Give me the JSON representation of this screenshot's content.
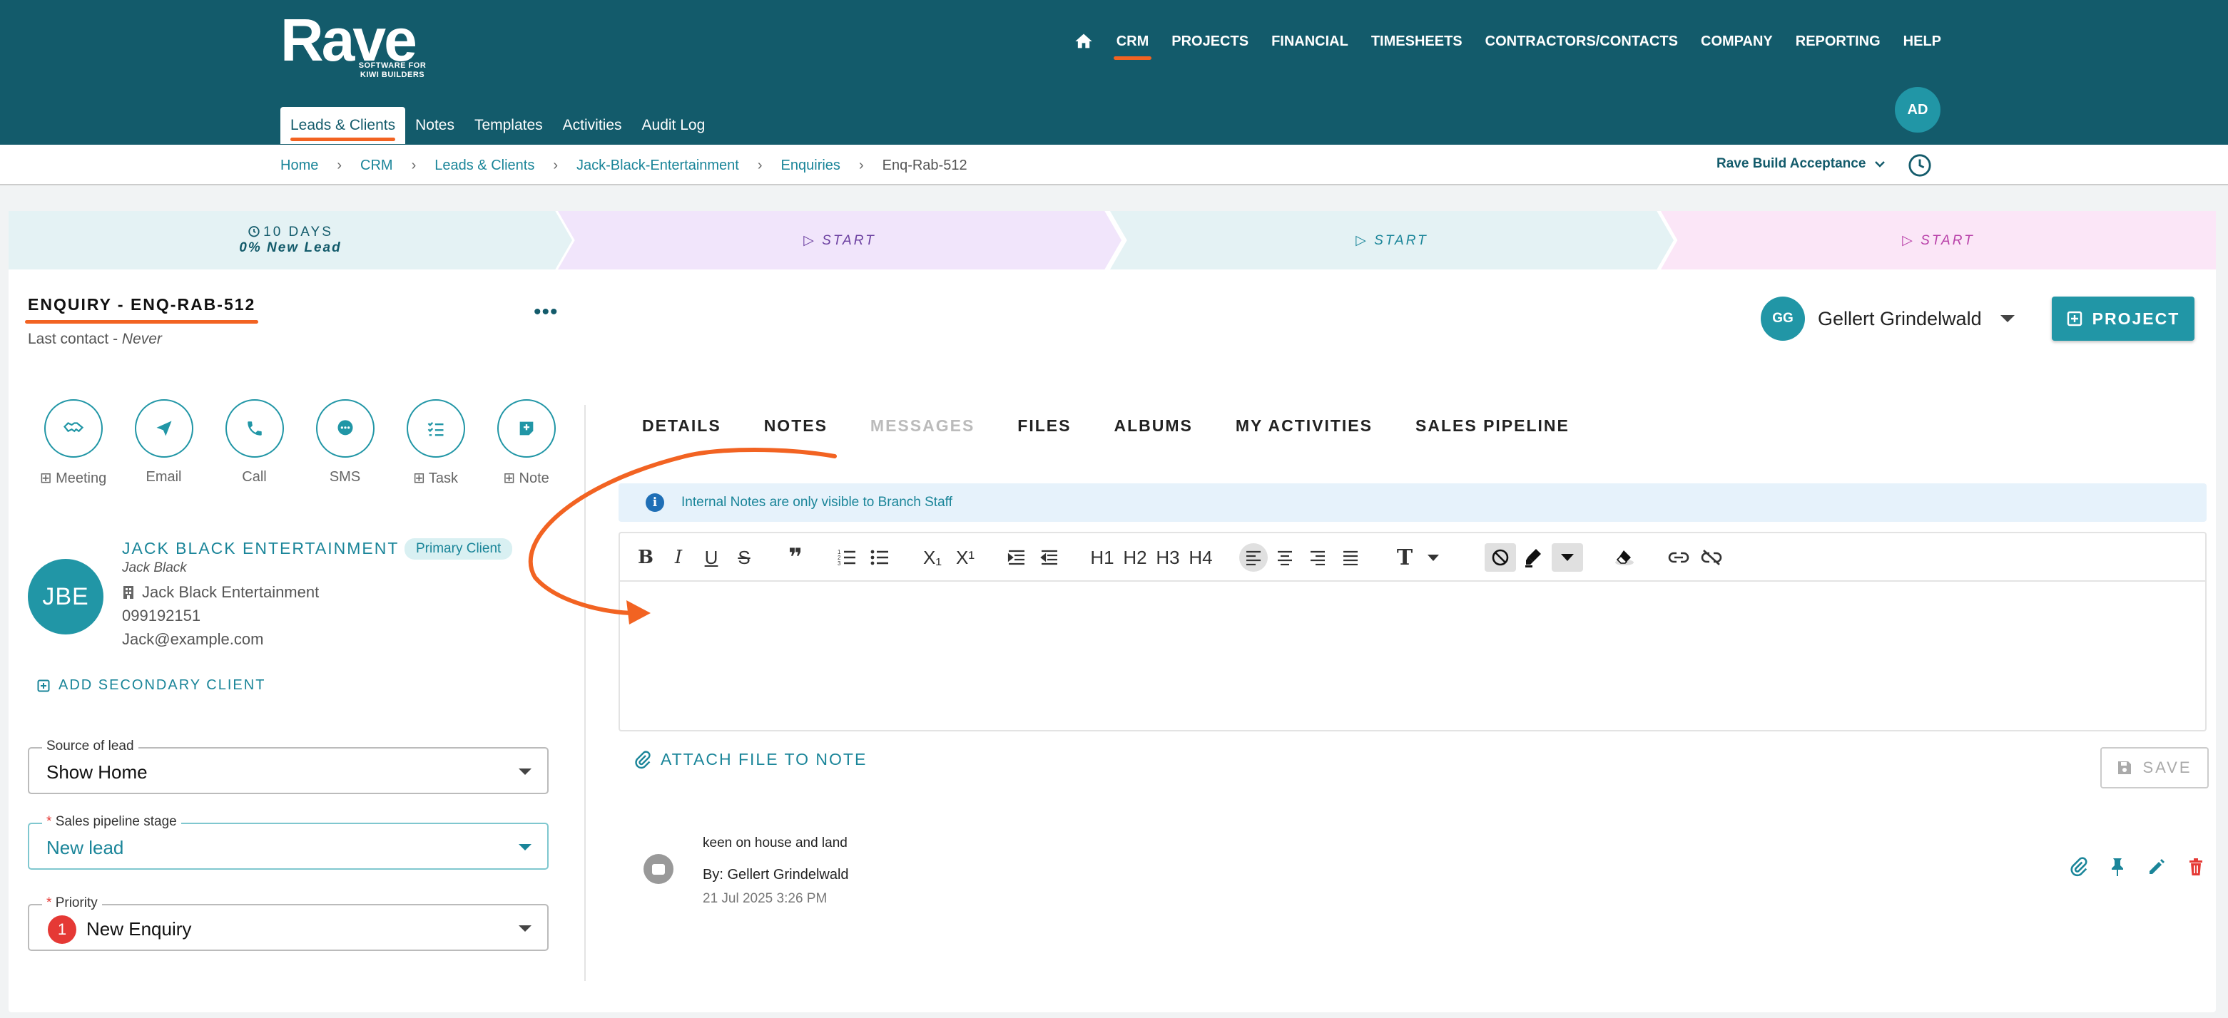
{
  "header": {
    "logo": "Rave",
    "logo_tagline": "SOFTWARE FOR KIWI BUILDERS",
    "nav": [
      "CRM",
      "PROJECTS",
      "FINANCIAL",
      "TIMESHEETS",
      "CONTRACTORS/CONTACTS",
      "COMPANY",
      "REPORTING",
      "HELP"
    ],
    "active_nav": "CRM",
    "avatar": "AD",
    "subnav": [
      "Leads & Clients",
      "Notes",
      "Templates",
      "Activities",
      "Audit Log"
    ]
  },
  "breadcrumb": {
    "items": [
      "Home",
      "CRM",
      "Leads & Clients",
      "Jack-Black-Entertainment",
      "Enquiries",
      "Enq-Rab-512"
    ],
    "branch": "Rave Build Acceptance"
  },
  "pipeline": {
    "days": "10 DAYS",
    "status": "0% New Lead",
    "start1": "START",
    "start2": "START",
    "start3": "START"
  },
  "enquiry": {
    "title": "ENQUIRY - ENQ-RAB-512",
    "last_contact_label": "Last contact - ",
    "last_contact_value": "Never"
  },
  "actions": [
    "Meeting",
    "Email",
    "Call",
    "SMS",
    "Task",
    "Note"
  ],
  "client": {
    "initials": "JBE",
    "name": "JACK BLACK ENTERTAINMENT",
    "badge": "Primary Client",
    "person": "Jack Black",
    "org": "Jack Black Entertainment",
    "phone": "099192151",
    "email": "Jack@example.com",
    "add_secondary": "ADD SECONDARY CLIENT"
  },
  "fields": {
    "source_label": "Source of lead",
    "source_value": "Show Home",
    "stage_label": "Sales pipeline stage",
    "stage_value": "New lead",
    "priority_label": "Priority",
    "priority_number": "1",
    "priority_value": "New Enquiry",
    "required_mark": "*"
  },
  "assignee": {
    "initials": "GG",
    "name": "Gellert Grindelwald"
  },
  "project_button": "PROJECT",
  "tabs": [
    "DETAILS",
    "NOTES",
    "MESSAGES",
    "FILES",
    "ALBUMS",
    "MY ACTIVITIES",
    "SALES PIPELINE"
  ],
  "info_banner": "Internal Notes are only visible to Branch Staff",
  "toolbar": {
    "bold": "B",
    "italic": "I",
    "underline": "U",
    "strike": "S",
    "h1": "H1",
    "h2": "H2",
    "h3": "H3",
    "h4": "H4",
    "text_style": "T"
  },
  "attach_label": "ATTACH FILE TO NOTE",
  "save_label": "SAVE",
  "note": {
    "text": "keen on house and land",
    "by": "By: Gellert Grindelwald",
    "date": "21 Jul 2025 3:26 PM"
  },
  "colors": {
    "header_bg": "#135b6b",
    "accent": "#2196a6",
    "highlight": "#f26322",
    "danger": "#e53935"
  }
}
